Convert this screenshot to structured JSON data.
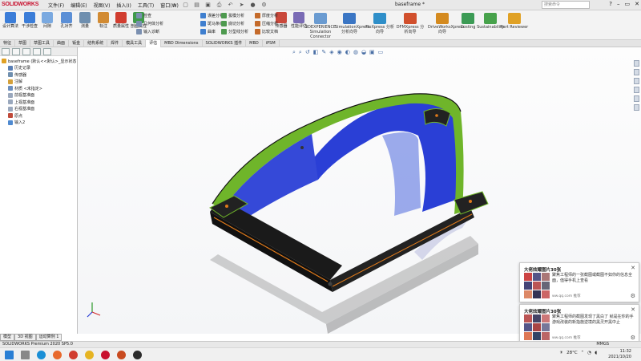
{
  "app": {
    "logo": "SOLIDWORKS",
    "doc_title": "baseframe *",
    "search_placeholder": "搜索命令",
    "menus": [
      "文件(F)",
      "编辑(E)",
      "视图(V)",
      "插入(I)",
      "工具(T)",
      "窗口(W)"
    ]
  },
  "ribbon": {
    "big_buttons": [
      {
        "label": "设计算法",
        "color": "#3b7dd8"
      },
      {
        "label": "干涉检查",
        "color": "#3b7dd8"
      },
      {
        "label": "间隙",
        "color": "#7aa9e0"
      },
      {
        "label": "孔对齐",
        "color": "#5b8fd6"
      },
      {
        "label": "测量",
        "color": "#6f8faf"
      },
      {
        "label": "标注",
        "color": "#d28b33"
      },
      {
        "label": "质量属性",
        "color": "#d13d2f"
      },
      {
        "label": "剖面属性",
        "color": "#3f9a4a"
      },
      {
        "label": "传感器",
        "color": "#c9483b"
      },
      {
        "label": "性能评估",
        "color": "#7a6bb5"
      }
    ],
    "small_group_a": [
      "检查",
      "几何体分析",
      "输入诊断"
    ],
    "small_group_b": [
      "误差分析",
      "斑马条纹",
      "曲率",
      "对称检查"
    ],
    "small_group_c": [
      "拔模分析",
      "底切分析",
      "分型线分析"
    ],
    "small_group_d": [
      "厚度分析",
      "压缩分析",
      "比较文档"
    ],
    "small_group_e": [
      "打印检查",
      "压缩分析",
      "比较文档"
    ],
    "extra_small": [
      "合适比较",
      "检查激活的文档"
    ],
    "addins": [
      {
        "label": "3DEXPERIENCE Simulation Connector",
        "color": "#6a9bd1"
      },
      {
        "label": "SimulationXpress 分析向导",
        "color": "#3b76c4"
      },
      {
        "label": "FloXpress 分析向导",
        "color": "#2f8fc9"
      },
      {
        "label": "DFMXpress 分析向导",
        "color": "#d14f2c"
      },
      {
        "label": "DriveWorksXpress 向导",
        "color": "#d48a1f"
      },
      {
        "label": "Costing",
        "color": "#3c9b55"
      },
      {
        "label": "Sustainability",
        "color": "#47a24b"
      },
      {
        "label": "Part Reviewer",
        "color": "#e0a125"
      }
    ]
  },
  "tabs": [
    "特征",
    "草图",
    "草图工具",
    "曲面",
    "钣金",
    "结构系统",
    "焊件",
    "模具工具",
    "评估",
    "MBD Dimensions",
    "SOLIDWORKS 插件",
    "MBD",
    "iPSM"
  ],
  "active_tab": 8,
  "feature_tree": {
    "root": "baseframe (默认<<默认>_显示状态",
    "items": [
      {
        "label": "历史记录",
        "color": "#5a7fb5"
      },
      {
        "label": "传感器",
        "color": "#6f8faf"
      },
      {
        "label": "注解",
        "color": "#d4a03a"
      },
      {
        "label": "材质 <未指定>",
        "color": "#6b8fbf"
      },
      {
        "label": "前视基准面",
        "color": "#9aa8bd"
      },
      {
        "label": "上视基准面",
        "color": "#9aa8bd"
      },
      {
        "label": "右视基准面",
        "color": "#9aa8bd"
      },
      {
        "label": "原点",
        "color": "#c04a3a"
      },
      {
        "label": "输入2",
        "color": "#4f8ad0"
      }
    ]
  },
  "panel_tabs": [
    "模型",
    "3D 视图",
    "运动算例 1"
  ],
  "notifications": [
    {
      "title": "大佬炫耀图片30张",
      "body": "聚焦工程师的一张截图或截图不如你的信息全面，值得手机上查看",
      "source": "ww.qq.com 推荐"
    },
    {
      "title": "大佬炫耀图片30张",
      "body": "聚焦工程师的截图发现了黑白了 就是在你的手游戏改装的新指施逆境的黑灵开黑中止",
      "source": "ww.qq.com 推荐"
    }
  ],
  "statusbar": {
    "left": "SOLIDWORKS Premium 2020 SP5.0",
    "right": "MMGS"
  },
  "taskbar": {
    "weather": "28°C",
    "time": "11:32",
    "date": "2021/10/20",
    "apps": [
      {
        "name": "windows-start",
        "color": "#2a7fd4"
      },
      {
        "name": "search",
        "color": "#888888"
      },
      {
        "name": "edge",
        "color": "#1a8fd6"
      },
      {
        "name": "firefox",
        "color": "#e8692c"
      },
      {
        "name": "chrome",
        "color": "#d13c2f"
      },
      {
        "name": "files",
        "color": "#e6b422"
      },
      {
        "name": "solidworks",
        "color": "#c8102e"
      },
      {
        "name": "powerpoint",
        "color": "#c84a1f"
      },
      {
        "name": "app-dark",
        "color": "#2c2c2c"
      }
    ]
  },
  "colors": {
    "frame_blue": "#2a3fd6",
    "frame_green": "#6fb52a",
    "frame_black": "#111111",
    "frame_orange": "#e07a1a"
  }
}
